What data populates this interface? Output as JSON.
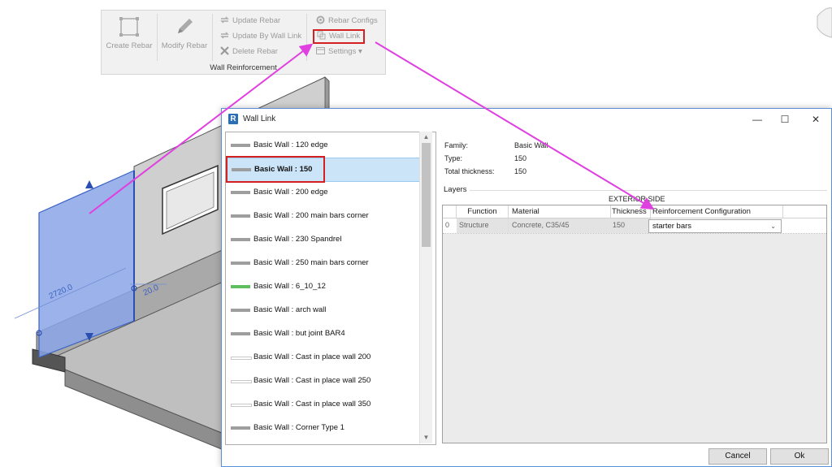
{
  "ribbon": {
    "create_rebar": "Create Rebar",
    "modify_rebar": "Modify Rebar",
    "update_rebar": "Update Rebar",
    "update_by_wall_link": "Update By Wall Link",
    "delete_rebar": "Delete Rebar",
    "rebar_configs": "Rebar Configs",
    "wall_link": "Wall Link",
    "settings": "Settings",
    "panel_title": "Wall Reinforcement"
  },
  "model": {
    "dim_length": "2720.0",
    "dim_thickness": "20.0"
  },
  "dialog": {
    "title": "Wall Link",
    "app_icon": "R",
    "minimize": "—",
    "maximize": "☐",
    "close": "✕",
    "wall_types": [
      {
        "label": "Basic Wall : 120 edge",
        "swatch": "gray"
      },
      {
        "label": "Basic Wall : 150",
        "swatch": "gray",
        "selected": true
      },
      {
        "label": "Basic Wall : 200 edge",
        "swatch": "gray"
      },
      {
        "label": "Basic Wall : 200 main bars corner",
        "swatch": "gray"
      },
      {
        "label": "Basic Wall : 230 Spandrel",
        "swatch": "gray"
      },
      {
        "label": "Basic Wall : 250 main bars corner",
        "swatch": "gray"
      },
      {
        "label": "Basic Wall : 6_10_12",
        "swatch": "green"
      },
      {
        "label": "Basic Wall : arch wall",
        "swatch": "gray"
      },
      {
        "label": "Basic Wall : but joint BAR4",
        "swatch": "gray"
      },
      {
        "label": "Basic Wall : Cast in place wall 200",
        "swatch": "outline"
      },
      {
        "label": "Basic Wall : Cast in place wall 250",
        "swatch": "outline"
      },
      {
        "label": "Basic Wall : Cast in place wall 350",
        "swatch": "outline"
      },
      {
        "label": "Basic Wall : Corner Type 1",
        "swatch": "gray"
      }
    ],
    "family_label": "Family:",
    "family_value": "Basic Wall",
    "type_label": "Type:",
    "type_value": "150",
    "thickness_label": "Total thickness:",
    "thickness_value": "150",
    "layers_label": "Layers",
    "exterior_side": "EXTERIOR SIDE",
    "columns": [
      "Function",
      "Material",
      "Thickness",
      "Reinforcement Configuration"
    ],
    "layer_rows": [
      {
        "index": "0",
        "function": "Structure",
        "material": "Concrete, C35/45",
        "thickness": "150",
        "config": "starter bars"
      }
    ],
    "cancel": "Cancel",
    "ok": "Ok"
  },
  "colors": {
    "highlight_box": "#d42020",
    "arrow": "#e040e0",
    "selection": "#cce4f7",
    "wall_highlight": "#7b9be0"
  }
}
